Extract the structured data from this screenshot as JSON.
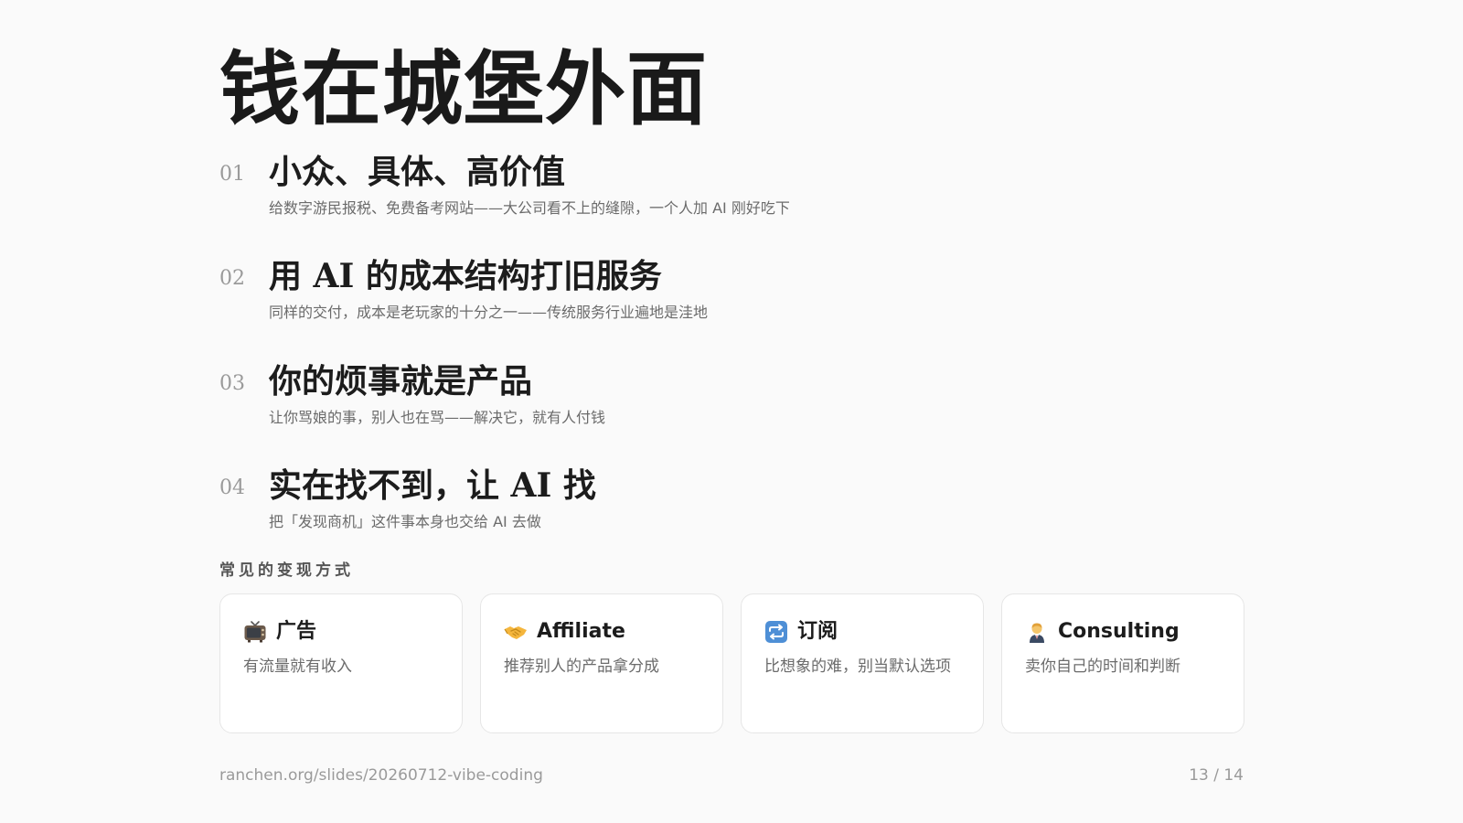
{
  "title": "钱在城堡外面",
  "points": [
    {
      "num": "01",
      "title": "小众、具体、高价值",
      "desc": "给数字游民报税、免费备考网站——大公司看不上的缝隙，一个人加 AI 刚好吃下"
    },
    {
      "num": "02",
      "title": "用 AI 的成本结构打旧服务",
      "desc": "同样的交付，成本是老玩家的十分之一——传统服务行业遍地是洼地"
    },
    {
      "num": "03",
      "title": "你的烦事就是产品",
      "desc": "让你骂娘的事，别人也在骂——解决它，就有人付钱"
    },
    {
      "num": "04",
      "title": "实在找不到，让 AI 找",
      "desc": "把「发现商机」这件事本身也交给 AI 去做"
    }
  ],
  "monetization": {
    "label": "常见的变现方式",
    "cards": [
      {
        "icon": "television-icon",
        "title": "广告",
        "desc": "有流量就有收入"
      },
      {
        "icon": "handshake-icon",
        "title": "Affiliate",
        "desc": "推荐别人的产品拿分成"
      },
      {
        "icon": "repeat-icon",
        "title": "订阅",
        "desc": "比想象的难，别当默认选项"
      },
      {
        "icon": "person-icon",
        "title": "Consulting",
        "desc": "卖你自己的时间和判断"
      }
    ]
  },
  "footer": {
    "url": "ranchen.org/slides/20260712-vibe-coding",
    "page": "13 / 14"
  },
  "colors": {
    "background": "#fafafa",
    "text": "#1c1c1c",
    "muted": "#6b6b6b",
    "faint": "#9a9a9a",
    "card_border": "#e6e6e6"
  }
}
